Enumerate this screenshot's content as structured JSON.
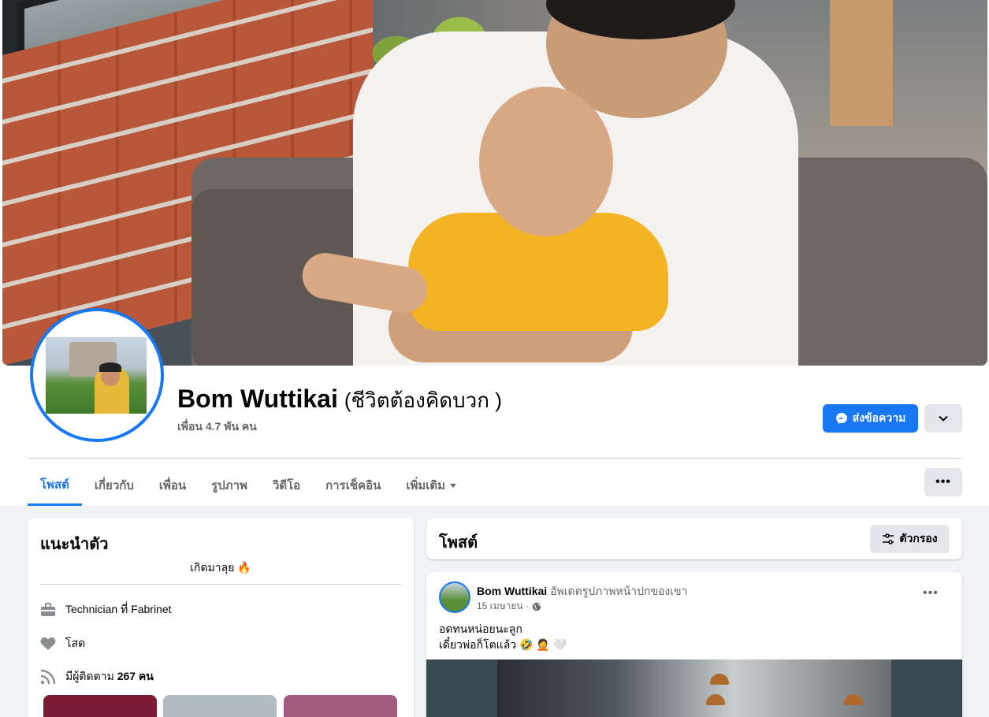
{
  "profile": {
    "name": "Bom Wuttikai",
    "alt_name": "(ชีวิตต้องคิดบวก )",
    "friends": "เพื่อน 4.7 พัน คน"
  },
  "actions": {
    "message_label": "ส่งข้อความ",
    "messenger_icon": "messenger-icon",
    "dropdown_icon": "chevron-down-icon",
    "more_icon": "more-dots-icon"
  },
  "tabs": [
    {
      "label": "โพสต์",
      "active": true
    },
    {
      "label": "เกี่ยวกับ"
    },
    {
      "label": "เพื่อน"
    },
    {
      "label": "รูปภาพ"
    },
    {
      "label": "วิดีโอ"
    },
    {
      "label": "การเช็คอิน"
    },
    {
      "label": "เพิ่มเติม"
    }
  ],
  "intro": {
    "title": "แนะนำตัว",
    "bio": "เกิดมาลุย 🔥",
    "work": "Technician ที่ Fabrinet",
    "relationship": "โสด",
    "followers_prefix": "มีผู้ติดตาม",
    "followers_count": "267 คน"
  },
  "posts": {
    "title": "โพสต์",
    "filter_label": "ตัวกรอง"
  },
  "post": {
    "author": "Bom Wuttikai",
    "action": "อัพเดตรูปภาพหน้าปกของเขา",
    "date": "15 เมษายน ·",
    "privacy_icon": "globe-icon",
    "line1": "อดทนหน่อยนะลูก",
    "line2": "เดี๋ยวพ่อก็โตแล้ว 🤣 🤦 🤍"
  },
  "colors": {
    "accent": "#1877f2",
    "background": "#f0f2f5",
    "secondary_text": "#65676b"
  }
}
